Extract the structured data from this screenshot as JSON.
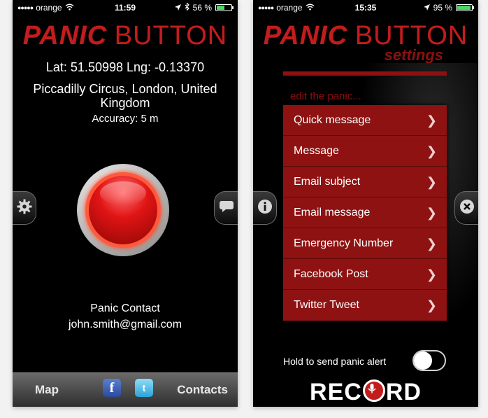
{
  "left_screen": {
    "status": {
      "carrier": "orange",
      "time": "11:59",
      "battery": "56 %",
      "battery_fraction": 0.56
    },
    "logo": {
      "word1": "PANIC",
      "word2": "BUTTON"
    },
    "location": {
      "coords": "Lat: 51.50998 Lng: -0.13370",
      "address_line1": "Piccadilly Circus, London, United",
      "address_line2": "Kingdom",
      "accuracy": "Accuracy: 5 m"
    },
    "contact": {
      "label": "Panic Contact",
      "email": "john.smith@gmail.com"
    },
    "bottom_bar": {
      "map_label": "Map",
      "contacts_label": "Contacts",
      "facebook_glyph": "f",
      "twitter_glyph": "t"
    },
    "icons": {
      "left_tab": "gear-icon",
      "right_tab": "speech-bubble-icon"
    }
  },
  "right_screen": {
    "status": {
      "carrier": "orange",
      "time": "15:35",
      "battery": "95 %",
      "battery_fraction": 0.95
    },
    "logo": {
      "word1": "PANIC",
      "word2": "BUTTON"
    },
    "subtitle": "settings",
    "edit_hint": "edit the panic...",
    "menu_items": [
      {
        "label": "Quick message"
      },
      {
        "label": "Message"
      },
      {
        "label": "Email subject"
      },
      {
        "label": "Email message"
      },
      {
        "label": "Emergency Number"
      },
      {
        "label": "Facebook Post"
      },
      {
        "label": "Twitter Tweet"
      }
    ],
    "hold_label": "Hold to send panic alert",
    "hold_toggle_on": false,
    "record": {
      "part1": "REC",
      "part2": "RD"
    },
    "icons": {
      "left_tab": "info-icon",
      "right_tab": "close-icon"
    }
  },
  "colors": {
    "accent_red": "#8e1212",
    "logo_red": "#c21d1d"
  }
}
